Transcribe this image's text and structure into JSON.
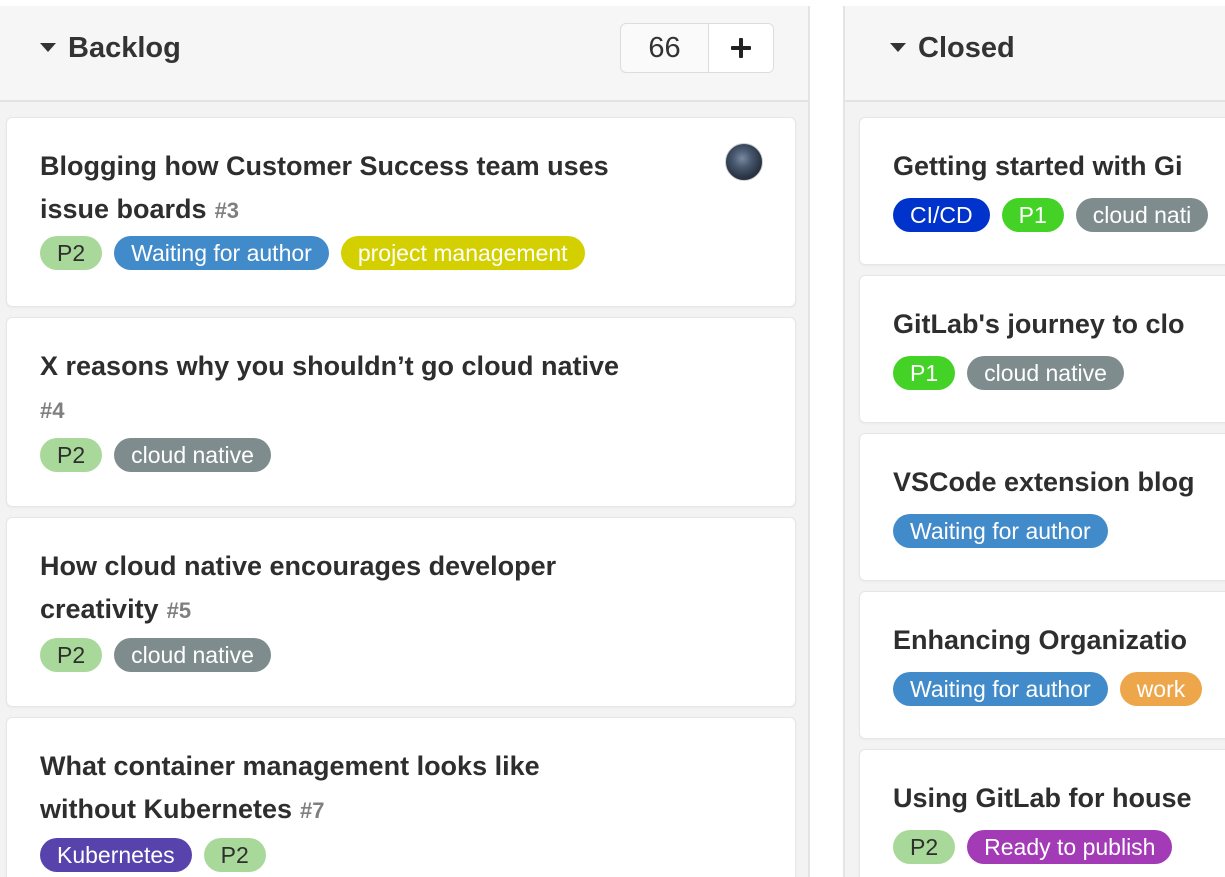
{
  "backlog": {
    "title": "Backlog",
    "count": "66",
    "cards": [
      {
        "title": "Blogging how Customer Success team uses issue boards",
        "number": "#3",
        "labels": [
          {
            "text": "P2",
            "color": "#a9d99a",
            "text_color": "#2e2e2e"
          },
          {
            "text": "Waiting for author",
            "color": "#428bca",
            "text_color": "#ffffff"
          },
          {
            "text": "project management",
            "color": "#d4d000",
            "text_color": "#ffffff"
          }
        ]
      },
      {
        "title": "X reasons why you shouldn’t go cloud native",
        "number": "#4",
        "labels": [
          {
            "text": "P2",
            "color": "#a9d99a",
            "text_color": "#2e2e2e"
          },
          {
            "text": "cloud native",
            "color": "#7f8c8d",
            "text_color": "#ffffff"
          }
        ]
      },
      {
        "title": "How cloud native encourages developer creativity",
        "number": "#5",
        "labels": [
          {
            "text": "P2",
            "color": "#a9d99a",
            "text_color": "#2e2e2e"
          },
          {
            "text": "cloud native",
            "color": "#7f8c8d",
            "text_color": "#ffffff"
          }
        ]
      },
      {
        "title": "What container management looks like without Kubernetes",
        "number": "#7",
        "labels": [
          {
            "text": "Kubernetes",
            "color": "#5843ad",
            "text_color": "#ffffff"
          },
          {
            "text": "P2",
            "color": "#a9d99a",
            "text_color": "#2e2e2e"
          }
        ]
      }
    ]
  },
  "closed": {
    "title": "Closed",
    "cards": [
      {
        "title": "Getting started with Gi",
        "labels": [
          {
            "text": "CI/CD",
            "color": "#0033cc",
            "text_color": "#ffffff"
          },
          {
            "text": "P1",
            "color": "#44d226",
            "text_color": "#ffffff"
          },
          {
            "text": "cloud nati",
            "color": "#7f8c8d",
            "text_color": "#ffffff"
          }
        ]
      },
      {
        "title": "GitLab's journey to clo",
        "labels": [
          {
            "text": "P1",
            "color": "#44d226",
            "text_color": "#ffffff"
          },
          {
            "text": "cloud native",
            "color": "#7f8c8d",
            "text_color": "#ffffff"
          }
        ]
      },
      {
        "title": "VSCode extension blog",
        "labels": [
          {
            "text": "Waiting for author",
            "color": "#428bca",
            "text_color": "#ffffff"
          }
        ]
      },
      {
        "title": "Enhancing Organizatio",
        "labels": [
          {
            "text": "Waiting for author",
            "color": "#428bca",
            "text_color": "#ffffff"
          },
          {
            "text": "work",
            "color": "#eea64a",
            "text_color": "#ffffff"
          }
        ]
      },
      {
        "title": "Using GitLab for house",
        "labels": [
          {
            "text": "P2",
            "color": "#a9d99a",
            "text_color": "#2e2e2e"
          },
          {
            "text": "Ready to publish",
            "color": "#a33ab6",
            "text_color": "#ffffff"
          }
        ]
      }
    ]
  }
}
